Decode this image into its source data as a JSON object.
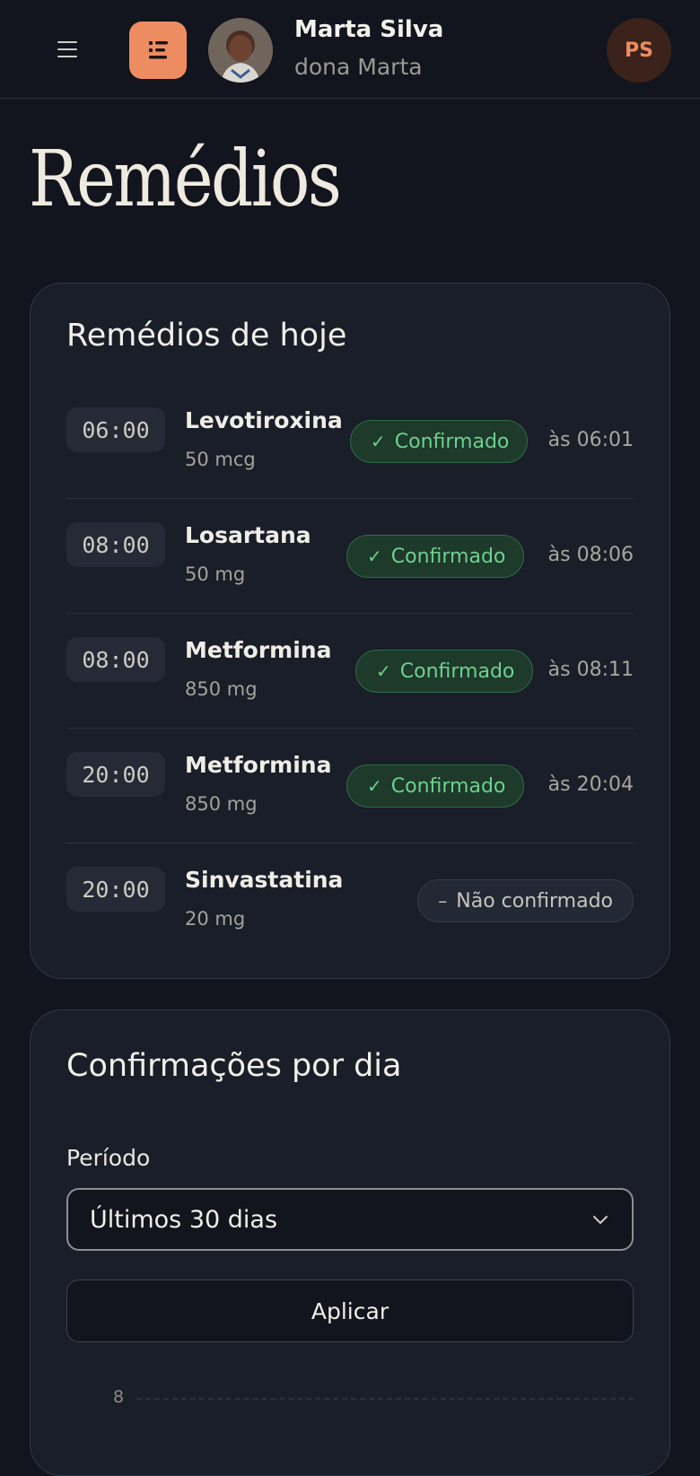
{
  "header": {
    "user_name": "Marta Silva",
    "user_nickname": "dona Marta",
    "user_initials": "PS"
  },
  "page": {
    "title": "Remédios"
  },
  "today": {
    "title": "Remédios de hoje",
    "items": [
      {
        "time": "06:00",
        "name": "Levotiroxina",
        "dose": "50 mcg",
        "status": "Confirmado",
        "confirmed_at": "às 06:01"
      },
      {
        "time": "08:00",
        "name": "Losartana",
        "dose": "50 mg",
        "status": "Confirmado",
        "confirmed_at": "às 08:06"
      },
      {
        "time": "08:00",
        "name": "Metformina",
        "dose": "850 mg",
        "status": "Confirmado",
        "confirmed_at": "às 08:11"
      },
      {
        "time": "20:00",
        "name": "Metformina",
        "dose": "850 mg",
        "status": "Confirmado",
        "confirmed_at": "às 20:04"
      },
      {
        "time": "20:00",
        "name": "Sinvastatina",
        "dose": "20 mg",
        "status": "Não confirmado",
        "confirmed_at": ""
      }
    ]
  },
  "chart_section": {
    "title": "Confirmações por dia",
    "period_label": "Período",
    "period_value": "Últimos 30 dias",
    "apply_label": "Aplicar",
    "y_tick_top": "8"
  },
  "colors": {
    "accent": "#ee8c61",
    "confirmed": "#6fd08f",
    "background": "#12151d",
    "card": "#1a1e28"
  }
}
